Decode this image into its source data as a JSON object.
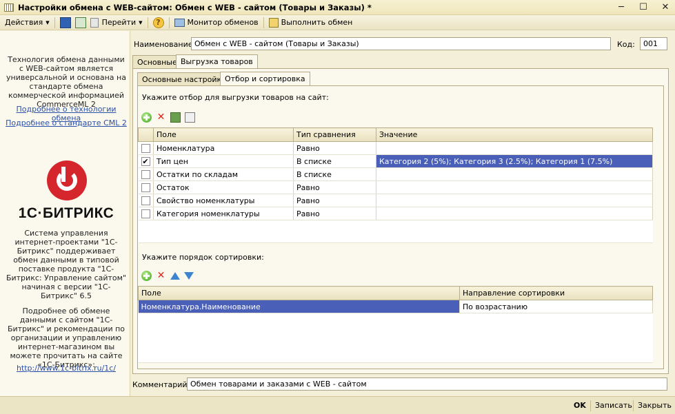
{
  "window": {
    "title": "Настройки обмена с WEB-сайтом: Обмен с WEB - сайтом (Товары и Заказы) *"
  },
  "toolbar": {
    "actions": "Действия",
    "goto": "Перейти",
    "monitor": "Монитор обменов",
    "run": "Выполнить обмен"
  },
  "sidebar": {
    "intro": "Технология обмена данными с WEB-сайтом является универсальной и основана на стандарте обмена коммерческой информацией CommerceML 2",
    "link_tech": "Подробнее о технологии обмена",
    "link_cml": "Подробнее о стандарте CML 2",
    "logo_text": "1С·БИТРИКС",
    "system_text": "Система управления интернет-проектами \"1С-Битрикс\" поддерживает обмен данными в типовой поставке продукта \"1С-Битрикс: Управление сайтом\" начиная с версии \"1С-Битрикс\" 6.5",
    "more_text": "Подробнее об обмене данными с сайтом \"1С-Битрикс\" и рекомендации по организации и управлению интернет-магазином вы можете прочитать на сайте «1С-Битрикс»:",
    "url": "http://www.1c-bitrix.ru/1c/"
  },
  "form": {
    "name_label": "Наименование:",
    "name_value": "Обмен с WEB - сайтом (Товары и Заказы)",
    "code_label": "Код:",
    "code_value": "001",
    "comment_label": "Комментарий:",
    "comment_value": "Обмен товарами и заказами с WEB - сайтом"
  },
  "tabs": {
    "main": "Основные",
    "export": "Выгрузка товаров"
  },
  "subtabs": {
    "basic": "Основные настройки",
    "filter": "Отбор и сортировка"
  },
  "filter": {
    "caption": "Укажите отбор для выгрузки товаров на сайт:",
    "columns": [
      "Поле",
      "Тип сравнения",
      "Значение"
    ],
    "rows": [
      {
        "checked": false,
        "field": "Номенклатура",
        "cmp": "Равно",
        "value": ""
      },
      {
        "checked": true,
        "field": "Тип цен",
        "cmp": "В списке",
        "value": "Категория 2 (5%); Категория 3 (2.5%); Категория 1 (7.5%)"
      },
      {
        "checked": false,
        "field": "Остатки по складам",
        "cmp": "В списке",
        "value": ""
      },
      {
        "checked": false,
        "field": "Остаток",
        "cmp": "Равно",
        "value": ""
      },
      {
        "checked": false,
        "field": "Свойство номенклатуры",
        "cmp": "Равно",
        "value": ""
      },
      {
        "checked": false,
        "field": "Категория номенклатуры",
        "cmp": "Равно",
        "value": ""
      }
    ]
  },
  "sort": {
    "caption": "Укажите порядок сортировки:",
    "columns": [
      "Поле",
      "Направление сортировки"
    ],
    "rows": [
      {
        "field": "Номенклатура.Наименование",
        "dir": "По возрастанию"
      }
    ]
  },
  "buttons": {
    "ok": "OK",
    "save": "Записать",
    "close": "Закрыть"
  },
  "colors": {
    "selection": "#4a5fb7",
    "logo_red": "#d4262c",
    "link": "#2a4fa6"
  }
}
